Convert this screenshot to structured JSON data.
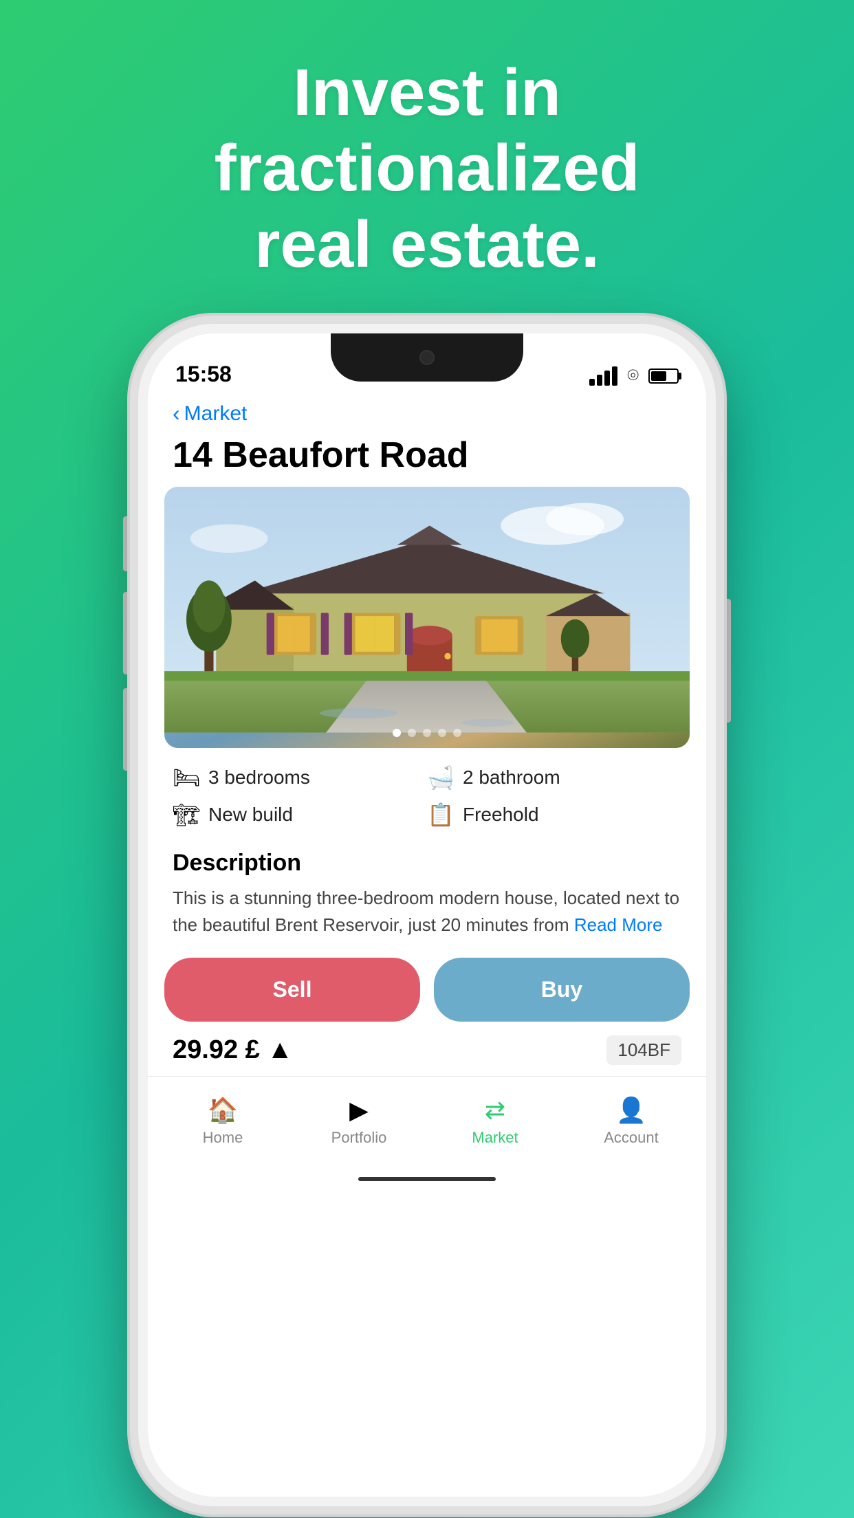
{
  "hero": {
    "line1": "Invest in",
    "line2": "fractionalized",
    "line3": "real estate."
  },
  "status_bar": {
    "time": "15:58"
  },
  "nav": {
    "back_label": "Market"
  },
  "property": {
    "title": "14 Beaufort Road",
    "image_dots": [
      true,
      false,
      false,
      false,
      false
    ],
    "features": [
      {
        "icon": "🛏",
        "text": "3 bedrooms"
      },
      {
        "icon": "🛁",
        "text": "2 bathroom"
      },
      {
        "icon": "🏗",
        "text": "New build"
      },
      {
        "icon": "📋",
        "text": "Freehold"
      }
    ],
    "description_title": "Description",
    "description_text": "This is a stunning three-bedroom modern house, located next to the beautiful Brent Reservoir, just 20 minutes from",
    "read_more": "Read More",
    "price": "29.92 £",
    "shares_label": "104BF",
    "sell_label": "Sell",
    "buy_label": "Buy"
  },
  "bottom_nav": {
    "items": [
      {
        "icon": "🏠",
        "label": "Home",
        "active": false
      },
      {
        "icon": "📄",
        "label": "Portfolio",
        "active": false
      },
      {
        "icon": "⇄",
        "label": "Market",
        "active": true
      },
      {
        "icon": "👤",
        "label": "Account",
        "active": false
      }
    ]
  }
}
